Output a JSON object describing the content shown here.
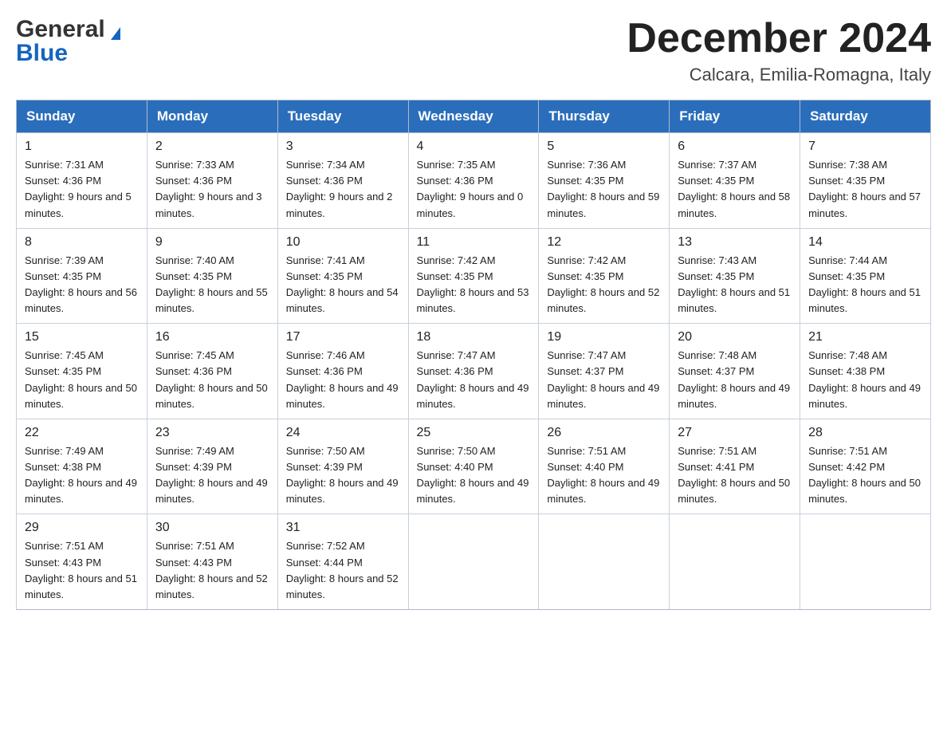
{
  "header": {
    "logo_general": "General",
    "logo_blue": "Blue",
    "month_title": "December 2024",
    "location": "Calcara, Emilia-Romagna, Italy"
  },
  "days_of_week": [
    "Sunday",
    "Monday",
    "Tuesday",
    "Wednesday",
    "Thursday",
    "Friday",
    "Saturday"
  ],
  "weeks": [
    [
      {
        "day": "1",
        "sunrise": "7:31 AM",
        "sunset": "4:36 PM",
        "daylight": "9 hours and 5 minutes."
      },
      {
        "day": "2",
        "sunrise": "7:33 AM",
        "sunset": "4:36 PM",
        "daylight": "9 hours and 3 minutes."
      },
      {
        "day": "3",
        "sunrise": "7:34 AM",
        "sunset": "4:36 PM",
        "daylight": "9 hours and 2 minutes."
      },
      {
        "day": "4",
        "sunrise": "7:35 AM",
        "sunset": "4:36 PM",
        "daylight": "9 hours and 0 minutes."
      },
      {
        "day": "5",
        "sunrise": "7:36 AM",
        "sunset": "4:35 PM",
        "daylight": "8 hours and 59 minutes."
      },
      {
        "day": "6",
        "sunrise": "7:37 AM",
        "sunset": "4:35 PM",
        "daylight": "8 hours and 58 minutes."
      },
      {
        "day": "7",
        "sunrise": "7:38 AM",
        "sunset": "4:35 PM",
        "daylight": "8 hours and 57 minutes."
      }
    ],
    [
      {
        "day": "8",
        "sunrise": "7:39 AM",
        "sunset": "4:35 PM",
        "daylight": "8 hours and 56 minutes."
      },
      {
        "day": "9",
        "sunrise": "7:40 AM",
        "sunset": "4:35 PM",
        "daylight": "8 hours and 55 minutes."
      },
      {
        "day": "10",
        "sunrise": "7:41 AM",
        "sunset": "4:35 PM",
        "daylight": "8 hours and 54 minutes."
      },
      {
        "day": "11",
        "sunrise": "7:42 AM",
        "sunset": "4:35 PM",
        "daylight": "8 hours and 53 minutes."
      },
      {
        "day": "12",
        "sunrise": "7:42 AM",
        "sunset": "4:35 PM",
        "daylight": "8 hours and 52 minutes."
      },
      {
        "day": "13",
        "sunrise": "7:43 AM",
        "sunset": "4:35 PM",
        "daylight": "8 hours and 51 minutes."
      },
      {
        "day": "14",
        "sunrise": "7:44 AM",
        "sunset": "4:35 PM",
        "daylight": "8 hours and 51 minutes."
      }
    ],
    [
      {
        "day": "15",
        "sunrise": "7:45 AM",
        "sunset": "4:35 PM",
        "daylight": "8 hours and 50 minutes."
      },
      {
        "day": "16",
        "sunrise": "7:45 AM",
        "sunset": "4:36 PM",
        "daylight": "8 hours and 50 minutes."
      },
      {
        "day": "17",
        "sunrise": "7:46 AM",
        "sunset": "4:36 PM",
        "daylight": "8 hours and 49 minutes."
      },
      {
        "day": "18",
        "sunrise": "7:47 AM",
        "sunset": "4:36 PM",
        "daylight": "8 hours and 49 minutes."
      },
      {
        "day": "19",
        "sunrise": "7:47 AM",
        "sunset": "4:37 PM",
        "daylight": "8 hours and 49 minutes."
      },
      {
        "day": "20",
        "sunrise": "7:48 AM",
        "sunset": "4:37 PM",
        "daylight": "8 hours and 49 minutes."
      },
      {
        "day": "21",
        "sunrise": "7:48 AM",
        "sunset": "4:38 PM",
        "daylight": "8 hours and 49 minutes."
      }
    ],
    [
      {
        "day": "22",
        "sunrise": "7:49 AM",
        "sunset": "4:38 PM",
        "daylight": "8 hours and 49 minutes."
      },
      {
        "day": "23",
        "sunrise": "7:49 AM",
        "sunset": "4:39 PM",
        "daylight": "8 hours and 49 minutes."
      },
      {
        "day": "24",
        "sunrise": "7:50 AM",
        "sunset": "4:39 PM",
        "daylight": "8 hours and 49 minutes."
      },
      {
        "day": "25",
        "sunrise": "7:50 AM",
        "sunset": "4:40 PM",
        "daylight": "8 hours and 49 minutes."
      },
      {
        "day": "26",
        "sunrise": "7:51 AM",
        "sunset": "4:40 PM",
        "daylight": "8 hours and 49 minutes."
      },
      {
        "day": "27",
        "sunrise": "7:51 AM",
        "sunset": "4:41 PM",
        "daylight": "8 hours and 50 minutes."
      },
      {
        "day": "28",
        "sunrise": "7:51 AM",
        "sunset": "4:42 PM",
        "daylight": "8 hours and 50 minutes."
      }
    ],
    [
      {
        "day": "29",
        "sunrise": "7:51 AM",
        "sunset": "4:43 PM",
        "daylight": "8 hours and 51 minutes."
      },
      {
        "day": "30",
        "sunrise": "7:51 AM",
        "sunset": "4:43 PM",
        "daylight": "8 hours and 52 minutes."
      },
      {
        "day": "31",
        "sunrise": "7:52 AM",
        "sunset": "4:44 PM",
        "daylight": "8 hours and 52 minutes."
      },
      null,
      null,
      null,
      null
    ]
  ]
}
